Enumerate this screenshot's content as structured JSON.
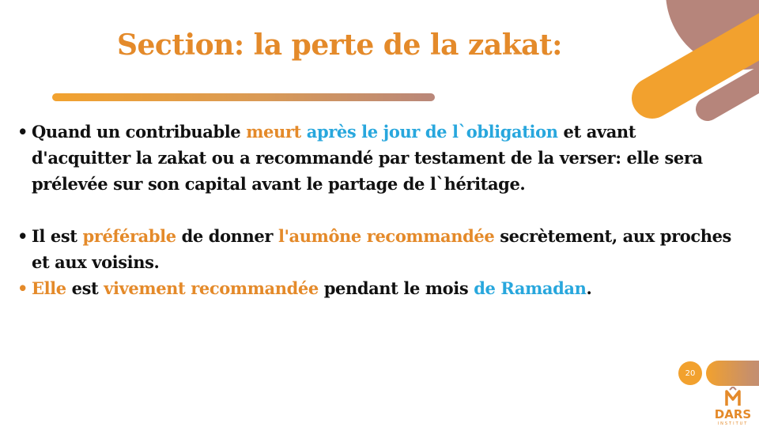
{
  "slide": {
    "title": "Section: la perte de la zakat:",
    "page_number": "20"
  },
  "bullet1": {
    "t1": "Quand un contribuable ",
    "t2": "meurt",
    "t3": " ",
    "t4": "après le jour de l`obligation",
    "t5": " et avant d'acquitter la zakat ou a recommandé par testament de la verser: elle sera prélevée sur son capital avant le partage de l`héritage."
  },
  "bullet2": {
    "t1": "Il est ",
    "t2": "préférable",
    "t3": " de donner ",
    "t4": "l'aumône recommandée",
    "t5": " secrètement, aux proches et aux voisins."
  },
  "bullet3": {
    "t1": "Elle",
    "t2": " est ",
    "t3": "vivement recommandée",
    "t4": " pendant le mois ",
    "t5": "de Ramadan",
    "t6": "."
  },
  "logo": {
    "text": "DARS",
    "subtext": "INSTITUT"
  },
  "colors": {
    "accent_orange": "#e48a2a",
    "accent_blue": "#28a7dd",
    "accent_brown": "#b6857b"
  }
}
